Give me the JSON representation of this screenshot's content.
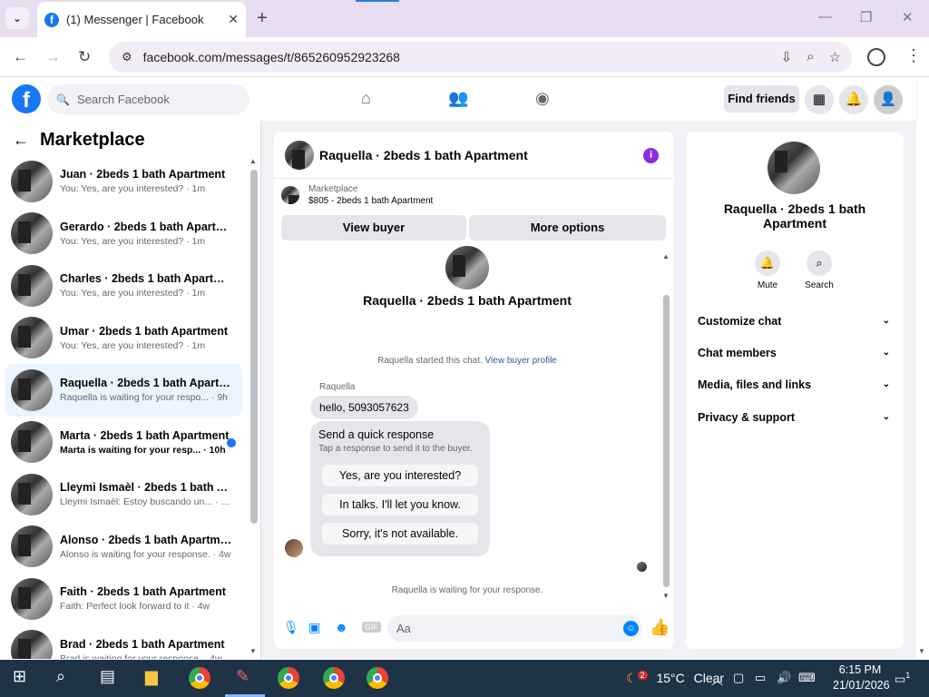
{
  "browser": {
    "tab_title": "(1) Messenger | Facebook",
    "url": "facebook.com/messages/t/865260952923268"
  },
  "header": {
    "search_placeholder": "Search Facebook",
    "find_friends": "Find friends"
  },
  "sidebar": {
    "title": "Marketplace",
    "chats": [
      {
        "name": "Juan · 2beds 1 bath Apartment",
        "preview": "You: Yes, are you interested? · 1m",
        "selected": false,
        "unread": false
      },
      {
        "name": "Gerardo · 2beds 1 bath Apartme...",
        "preview": "You: Yes, are you interested? · 1m",
        "selected": false,
        "unread": false
      },
      {
        "name": "Charles · 2beds 1 bath Apartment",
        "preview": "You: Yes, are you interested? · 1m",
        "selected": false,
        "unread": false
      },
      {
        "name": "Umar · 2beds 1 bath Apartment",
        "preview": "You: Yes, are you interested? · 1m",
        "selected": false,
        "unread": false
      },
      {
        "name": "Raquella · 2beds 1 bath Apartm...",
        "preview": "Raquella is waiting for your respo... · 9h",
        "selected": true,
        "unread": false
      },
      {
        "name": "Marta · 2beds 1 bath Apartment",
        "preview": "Marta is waiting for your resp... · 10h",
        "selected": false,
        "unread": true
      },
      {
        "name": "Lleymi Ismaèl · 2beds 1 bath Ap...",
        "preview": "Lleymi Ismaèl: Estoy buscando un... · 1w",
        "selected": false,
        "unread": false
      },
      {
        "name": "Alonso · 2beds 1 bath Apartment",
        "preview": "Alonso is waiting for your response. · 4w",
        "selected": false,
        "unread": false
      },
      {
        "name": "Faith · 2beds 1 bath Apartment",
        "preview": "Faith: Perfect look forward to it · 4w",
        "selected": false,
        "unread": false
      },
      {
        "name": "Brad · 2beds 1 bath Apartment",
        "preview": "Brad is waiting for your response. · 4w",
        "selected": false,
        "unread": false
      }
    ]
  },
  "chat": {
    "title": "Raquella · 2beds 1 bath Apartment",
    "marketplace_label": "Marketplace",
    "listing": "$805 - 2beds 1 bath Apartment",
    "view_buyer": "View buyer",
    "more_options": "More options",
    "started_text": "Raquella started this chat.",
    "view_profile": "View buyer profile",
    "sender": "Raquella",
    "message": "hello, 5093057623",
    "quick_title": "Send a quick response",
    "quick_sub": "Tap a response to send it to the buyer.",
    "quick_options": [
      "Yes, are you interested?",
      "In talks. I'll let you know.",
      "Sorry, it's not available."
    ],
    "waiting": "Raquella is waiting for your response.",
    "input_placeholder": "Aa"
  },
  "details": {
    "name": "Raquella · 2beds 1 bath Apartment",
    "mute": "Mute",
    "search": "Search",
    "sections": [
      "Customize chat",
      "Chat members",
      "Media, files and links",
      "Privacy & support"
    ]
  },
  "taskbar": {
    "weather_badge": "2",
    "temperature": "15°C",
    "condition": "Clear",
    "time": "6:15 PM",
    "date": "21/01/2026",
    "notifications": "1"
  },
  "colors": {
    "fb_blue": "#1877f2",
    "messenger_blue": "#0084ff",
    "info_purple": "#8a2be2",
    "unread_dot": "#1877f2"
  }
}
